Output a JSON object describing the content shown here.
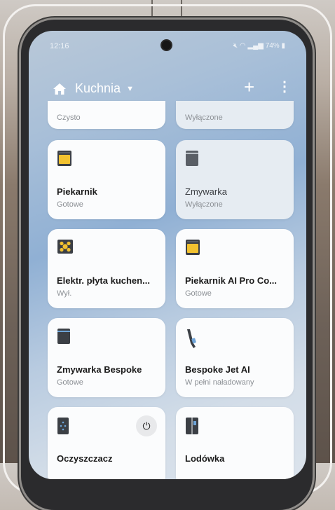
{
  "status_bar": {
    "time": "12:16",
    "battery": "74%"
  },
  "header": {
    "title": "Kuchnia",
    "add_icon": "plus-icon",
    "more_icon": "more-vertical-icon"
  },
  "colors": {
    "accent_yellow": "#f2c230",
    "dark_icon": "#3b3f45",
    "card_bg": "#fbfcfd",
    "card_off_bg": "#e6ecf2"
  },
  "devices": [
    {
      "name": "",
      "status": "Czysto",
      "state": "on"
    },
    {
      "name": "",
      "status": "Wyłączone",
      "state": "off"
    },
    {
      "name": "Piekarnik",
      "status": "Gotowe",
      "icon": "oven-icon",
      "state": "on"
    },
    {
      "name": "Zmywarka",
      "status": "Wyłączone",
      "icon": "dishwasher-icon",
      "state": "off"
    },
    {
      "name": "Elektr. płyta kuchen...",
      "status": "Wył.",
      "icon": "cooktop-icon",
      "state": "on"
    },
    {
      "name": "Piekarnik AI Pro Co...",
      "status": "Gotowe",
      "icon": "oven-icon",
      "state": "on"
    },
    {
      "name": "Zmywarka Bespoke",
      "status": "Gotowe",
      "icon": "dishwasher-icon",
      "state": "on"
    },
    {
      "name": "Bespoke Jet AI",
      "status": "W pełni naładowany",
      "icon": "stick-vacuum-icon",
      "state": "on"
    },
    {
      "name": "Oczyszczacz",
      "status": "",
      "icon": "air-purifier-icon",
      "state": "on"
    },
    {
      "name": "Lodówka",
      "status": "",
      "icon": "fridge-icon",
      "state": "on"
    }
  ]
}
